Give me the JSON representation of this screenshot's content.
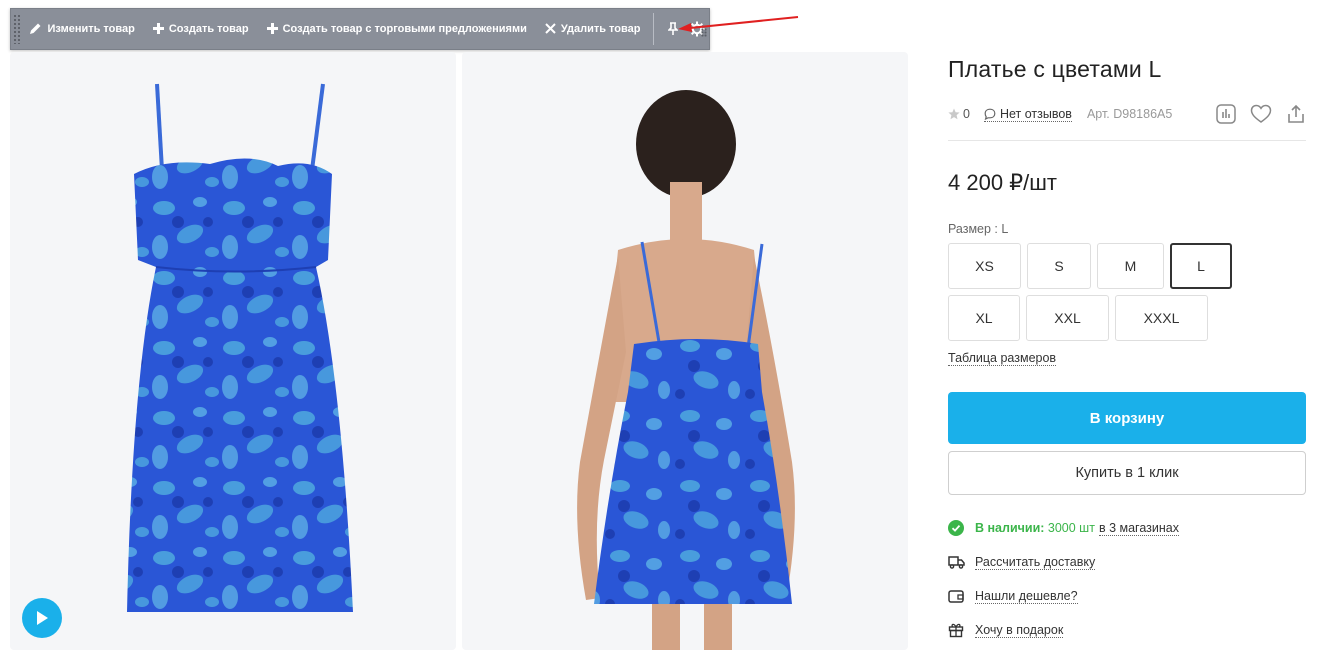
{
  "admin_bar": {
    "edit_label": "Изменить товар",
    "create_label": "Создать товар",
    "create_offers_label": "Создать товар с торговыми предложениями",
    "delete_label": "Удалить товар"
  },
  "product": {
    "title": "Платье с цветами L",
    "rating": "0",
    "reviews": "Нет отзывов",
    "article": "Арт. D98186A5",
    "price": "4 200 ₽/шт",
    "size_label": "Размер : L",
    "sizes": [
      {
        "label": "XS",
        "selected": false
      },
      {
        "label": "S",
        "selected": false
      },
      {
        "label": "M",
        "selected": false
      },
      {
        "label": "L",
        "selected": true
      },
      {
        "label": "XL",
        "selected": false
      },
      {
        "label": "XXL",
        "selected": false
      },
      {
        "label": "XXXL",
        "selected": false
      }
    ],
    "size_table": "Таблица размеров",
    "cart_button": "В корзину",
    "one_click_button": "Купить в 1 клик",
    "stock_status": "В наличии:",
    "stock_count": "3000 шт",
    "stock_stores": "в 3 магазинах",
    "delivery": "Рассчитать доставку",
    "cheaper": "Нашли дешевле?",
    "gift": "Хочу в подарок"
  },
  "colors": {
    "accent": "#1ab0ea",
    "in_stock": "#3bb54a",
    "admin_bar": "#8a8f99",
    "arrow": "#e02020",
    "dress_base": "#2a56d6",
    "dress_light": "#4fa9de"
  },
  "icons": {
    "edit": "pencil-icon",
    "create": "plus-icon",
    "delete": "close-icon",
    "pin": "pin-icon",
    "settings": "gear-icon",
    "rating": "star-icon",
    "reviews": "chat-bubble-icon",
    "compare": "chart-icon",
    "favorite": "heart-icon",
    "share": "share-icon",
    "video": "play-icon",
    "stock": "check-circle-icon",
    "delivery": "truck-icon",
    "cheaper": "wallet-icon",
    "gift": "gift-icon"
  }
}
